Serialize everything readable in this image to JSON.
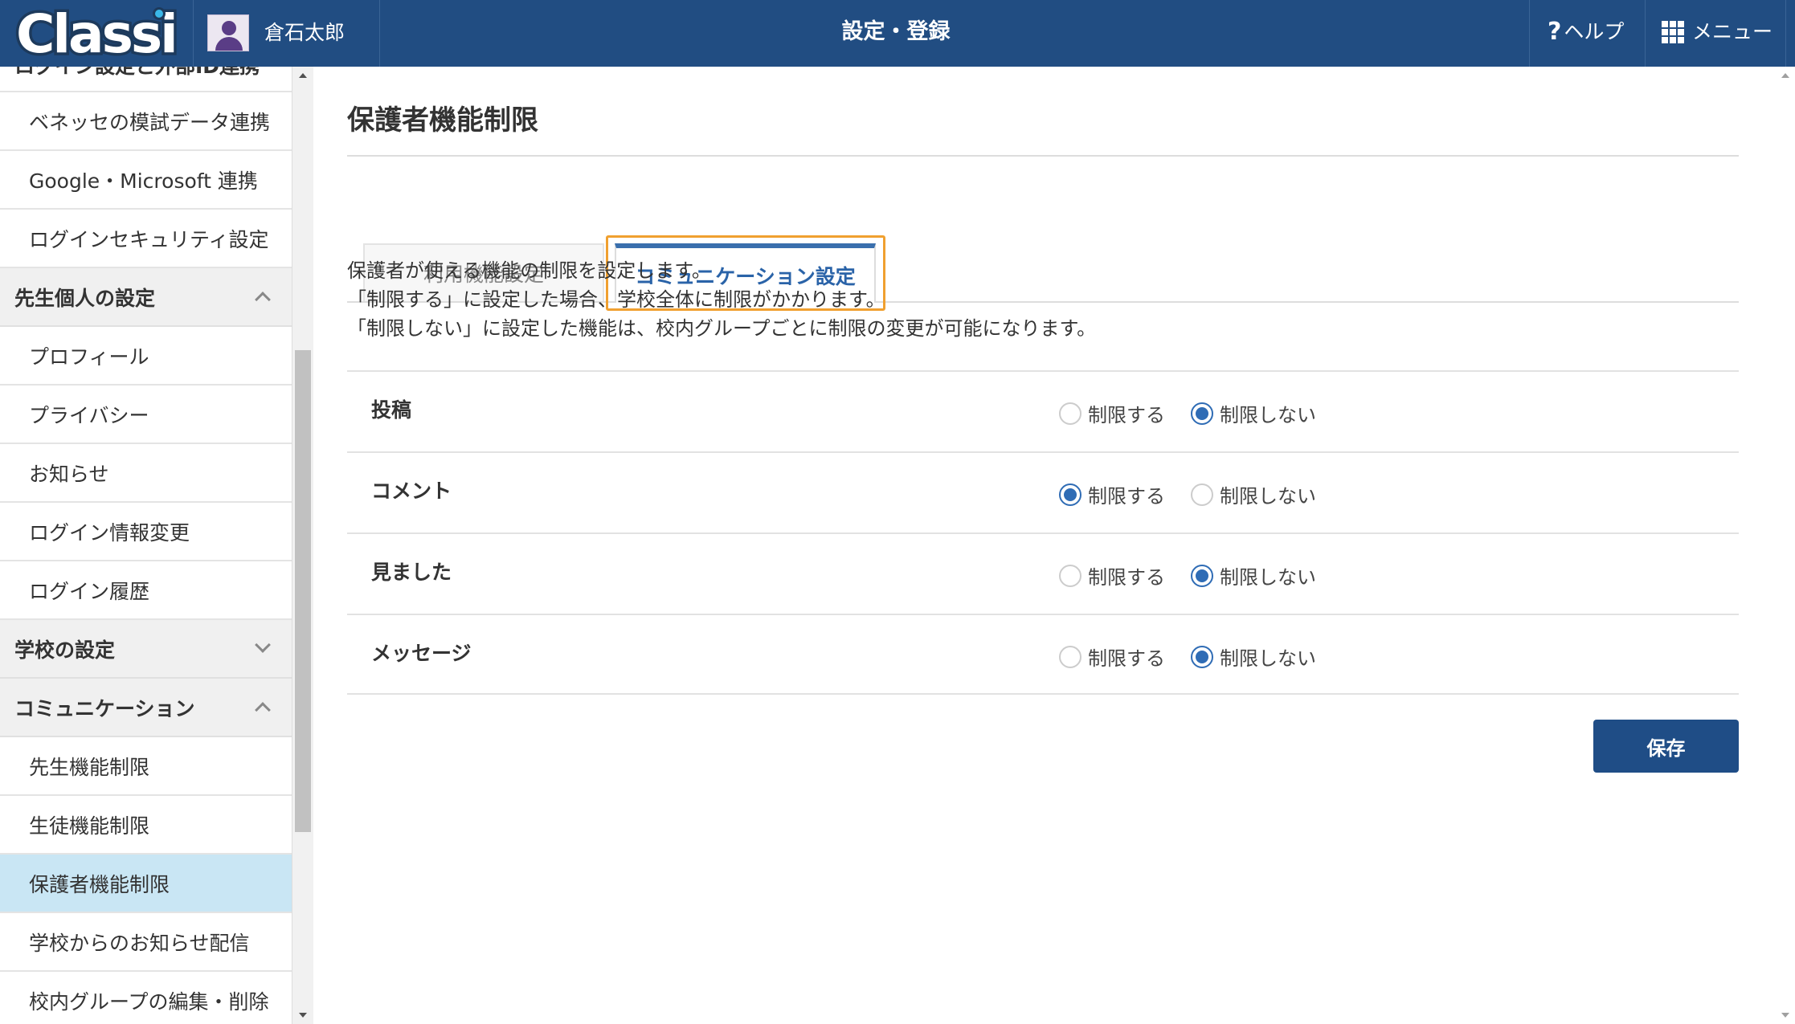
{
  "header": {
    "logo_text": "Classi",
    "user_name": "倉石太郎",
    "title": "設定・登録",
    "help_label": "ヘルプ",
    "menu_label": "メニュー"
  },
  "sidebar": {
    "partial_heading": "ログイン設定と外部ID連携",
    "items": [
      {
        "label": "ベネッセの模試データ連携",
        "type": "item"
      },
      {
        "label": "Google・Microsoft 連携",
        "type": "item"
      },
      {
        "label": "ログインセキュリティ設定",
        "type": "item"
      },
      {
        "label": "先生個人の設定",
        "type": "section",
        "expanded": true
      },
      {
        "label": "プロフィール",
        "type": "item"
      },
      {
        "label": "プライバシー",
        "type": "item"
      },
      {
        "label": "お知らせ",
        "type": "item"
      },
      {
        "label": "ログイン情報変更",
        "type": "item"
      },
      {
        "label": "ログイン履歴",
        "type": "item"
      },
      {
        "label": "学校の設定",
        "type": "section",
        "expanded": false
      },
      {
        "label": "コミュニケーション",
        "type": "section",
        "expanded": true
      },
      {
        "label": "先生機能制限",
        "type": "item"
      },
      {
        "label": "生徒機能制限",
        "type": "item"
      },
      {
        "label": "保護者機能制限",
        "type": "item",
        "active": true
      },
      {
        "label": "学校からのお知らせ配信",
        "type": "item"
      },
      {
        "label": "校内グループの編集・削除",
        "type": "item"
      }
    ]
  },
  "main": {
    "page_title": "保護者機能制限",
    "tabs": [
      {
        "label": "利用機能設定",
        "active": false
      },
      {
        "label": "コミュニケーション設定",
        "active": true
      }
    ],
    "description": [
      "保護者が使える機能の制限を設定します。",
      "「制限する」に設定した場合、学校全体に制限がかかります。",
      "「制限しない」に設定した機能は、校内グループごとに制限の変更が可能になります。"
    ],
    "option_labels": {
      "restrict": "制限する",
      "no_restrict": "制限しない"
    },
    "settings": [
      {
        "label": "投稿",
        "value": "制限しない"
      },
      {
        "label": "コメント",
        "value": "制限する"
      },
      {
        "label": "見ました",
        "value": "制限しない"
      },
      {
        "label": "メッセージ",
        "value": "制限しない"
      }
    ],
    "save_label": "保存"
  },
  "colors": {
    "header_bg": "#214d82",
    "accent": "#2f6cb5",
    "active_item_bg": "#c9e6f4",
    "tab_highlight": "#f0a030",
    "save_button_bg": "#1f4d86"
  }
}
